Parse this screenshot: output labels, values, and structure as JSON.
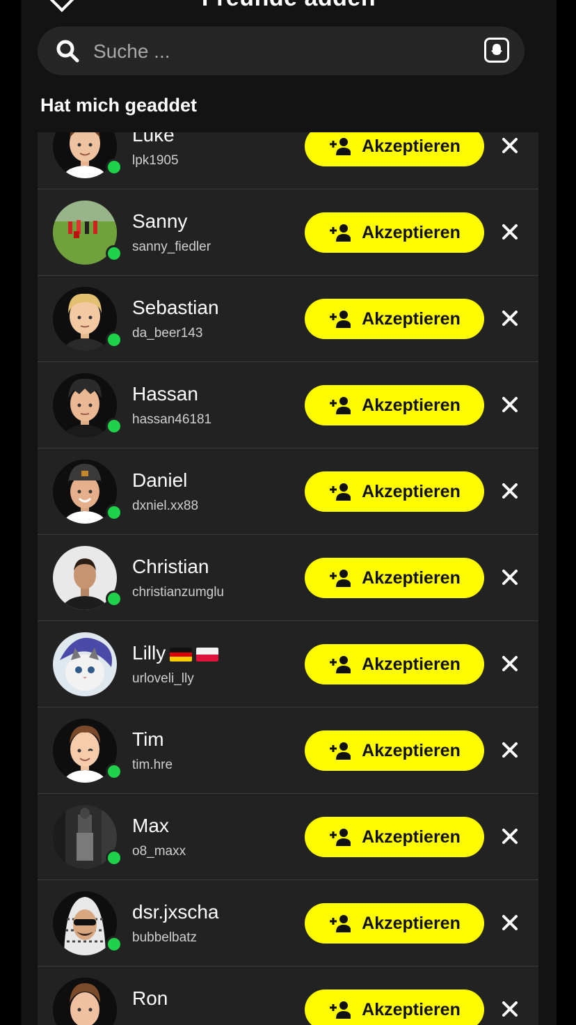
{
  "header": {
    "title": "Freunde adden",
    "search_placeholder": "Suche ...",
    "section_title": "Hat mich geaddet"
  },
  "accept_label": "Akzeptieren",
  "colors": {
    "accent": "#fffc00",
    "online": "#1fd14b",
    "row_bg": "#222223"
  },
  "icons": [
    "back-chevron-icon",
    "more-icon",
    "search-icon",
    "snapcode-icon",
    "add-user-icon",
    "close-icon",
    "flag-germany-icon",
    "flag-poland-icon"
  ],
  "requests": [
    {
      "name": "Luke",
      "username": "lpk1905"
    },
    {
      "name": "Sanny",
      "username": "sanny_fiedler"
    },
    {
      "name": "Sebastian",
      "username": "da_beer143"
    },
    {
      "name": "Hassan",
      "username": "hassan46181"
    },
    {
      "name": "Daniel",
      "username": "dxniel.xx88"
    },
    {
      "name": "Christian",
      "username": "christianzumglu"
    },
    {
      "name": "Lilly",
      "username": "urloveli_lly"
    },
    {
      "name": "Tim",
      "username": "tim.hre"
    },
    {
      "name": "Max",
      "username": "o8_maxx"
    },
    {
      "name": "dsr.jxscha",
      "username": "bubbelbatz"
    },
    {
      "name": "Ron",
      "username": ""
    }
  ]
}
